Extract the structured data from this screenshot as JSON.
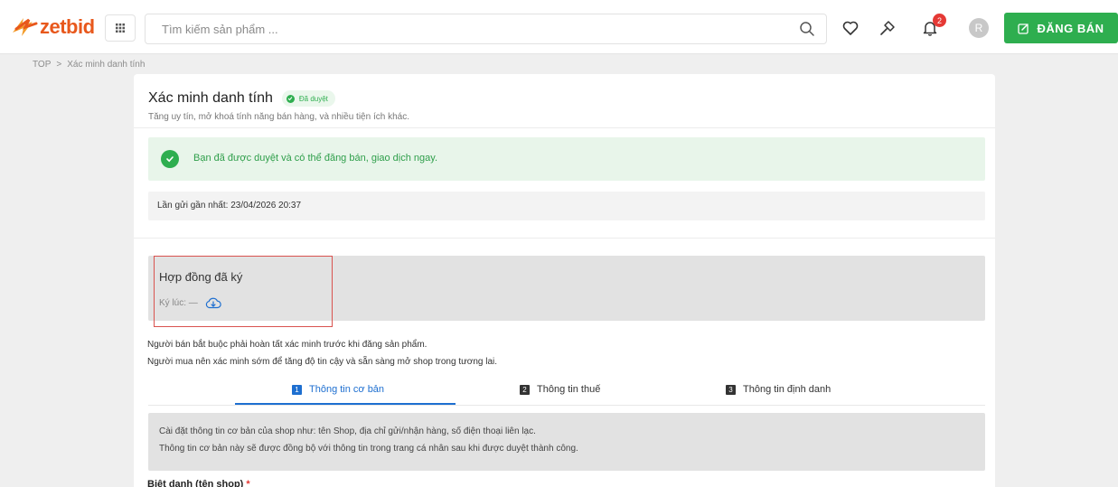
{
  "header": {
    "logo_text": "zetbid",
    "search_placeholder": "Tìm kiếm sản phẩm ...",
    "notification_count": "2",
    "avatar_initial": "R",
    "sell_button": "ĐĂNG BÁN",
    "brand_color": "#e8581c",
    "accent_green": "#2eae4f"
  },
  "breadcrumb": {
    "items": [
      "TOP",
      "Xác minh danh tính"
    ],
    "separator": ">"
  },
  "page": {
    "title": "Xác minh danh tính",
    "status_badge": "Đã duyệt",
    "subtitle": "Tăng uy tín, mở khoá tính năng bán hàng, và nhiều tiện ích khác.",
    "success_message": "Bạn đã được duyệt và có thể đăng bán, giao dịch ngay.",
    "last_sent": "Lần gửi gần nhất: 23/04/2026 20:37",
    "contract": {
      "title": "Hợp đồng đã ký",
      "signed_at_label": "Ký lúc: —"
    },
    "notes": [
      "Người bán bắt buộc phải hoàn tất xác minh trước khi đăng sản phẩm.",
      "Người mua nên xác minh sớm để tăng độ tin cậy và sẵn sàng mở shop trong tương lai."
    ],
    "tabs": [
      {
        "num": "1",
        "label": "Thông tin cơ bản",
        "active": true
      },
      {
        "num": "2",
        "label": "Thông tin thuế",
        "active": false
      },
      {
        "num": "3",
        "label": "Thông tin định danh",
        "active": false
      }
    ],
    "info_lines": [
      "Cài đặt thông tin cơ bản của shop như: tên Shop, địa chỉ gửi/nhận hàng, số điện thoại liên lạc.",
      "Thông tin cơ bản này sẽ được đồng bộ với thông tin trong trang cá nhân sau khi được duyệt thành công."
    ],
    "field_label": "Biệt danh (tên shop)",
    "required_mark": "*"
  }
}
